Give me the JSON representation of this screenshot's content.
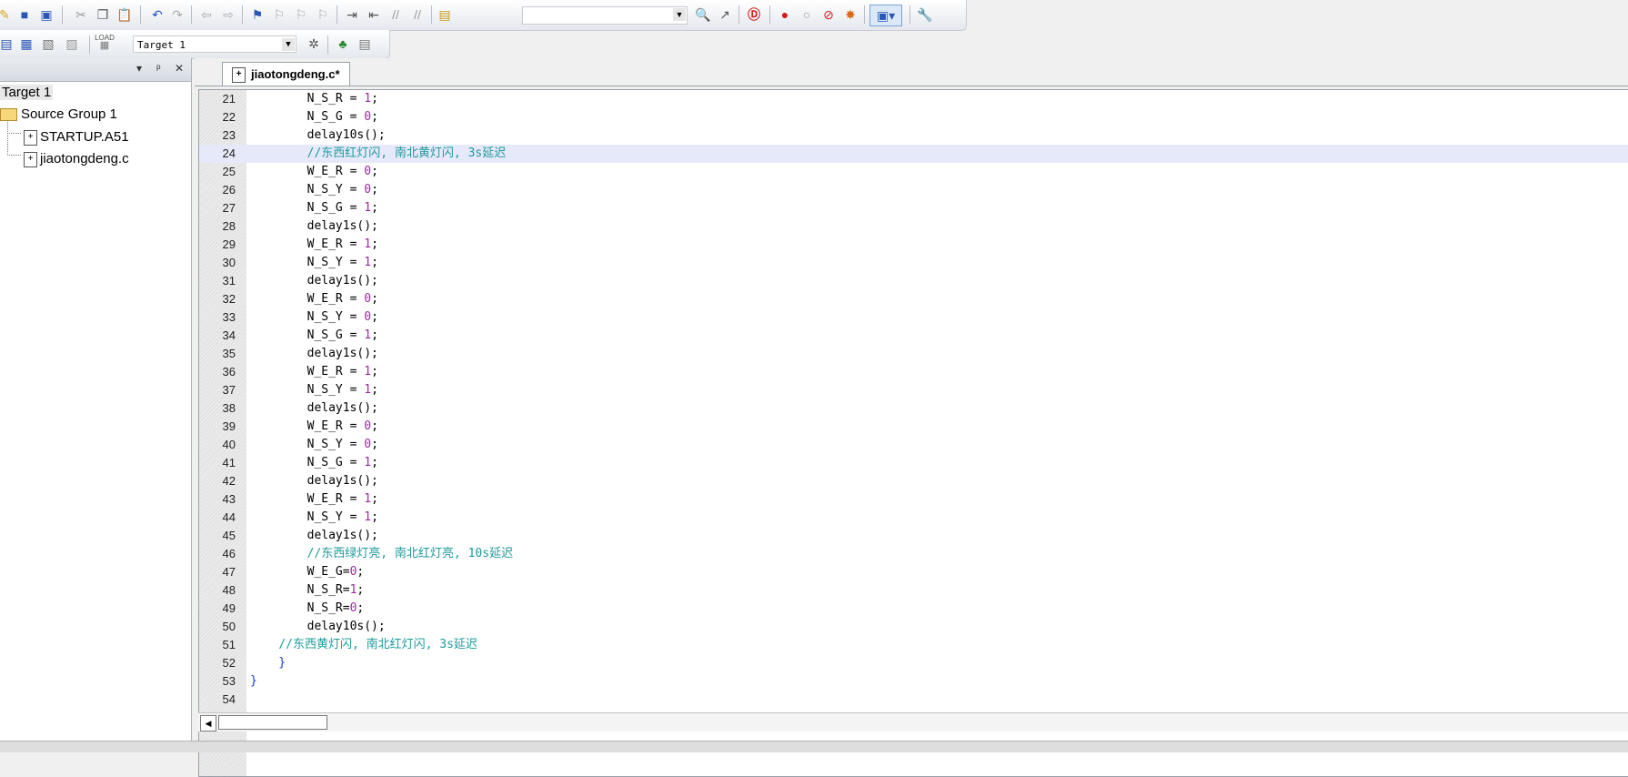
{
  "toolbar": {
    "icons": [
      "new-file-icon",
      "save-icon",
      "save-all-icon",
      "cut-icon",
      "copy-icon",
      "paste-icon",
      "undo-icon",
      "redo-icon",
      "back-icon",
      "forward-icon",
      "bookmark-icon",
      "prev-bookmark-icon",
      "next-bookmark-icon",
      "clear-bookmarks-icon",
      "indent-icon",
      "unindent-icon",
      "comment-icon",
      "uncomment-icon",
      "find-in-files-icon",
      "search-icon",
      "incremental-find-icon",
      "debug-icon",
      "breakpoint-icon",
      "disable-breakpoint-icon",
      "kill-breakpoints-icon",
      "enable-breakpoints-icon",
      "window-icon",
      "settings-icon"
    ],
    "find_value": ""
  },
  "build_toolbar": {
    "target_value": "Target 1",
    "load_label": "LOAD"
  },
  "project": {
    "target": "Target 1",
    "group": "Source Group 1",
    "files": [
      "STARTUP.A51",
      "jiaotongdeng.c"
    ]
  },
  "editor": {
    "tab_label": "jiaotongdeng.c*",
    "highlighted_line": 24,
    "lines": [
      {
        "n": "21",
        "code": "        N_S_R = 1;"
      },
      {
        "n": "22",
        "code": "        N_S_G = 0;"
      },
      {
        "n": "23",
        "code": "        delay10s();"
      },
      {
        "n": "24",
        "code": "        //东西红灯闪, 南北黄灯闪, 3s延迟"
      },
      {
        "n": "25",
        "code": "        W_E_R = 0;"
      },
      {
        "n": "26",
        "code": "        N_S_Y = 0;"
      },
      {
        "n": "27",
        "code": "        N_S_G = 1;"
      },
      {
        "n": "28",
        "code": "        delay1s();"
      },
      {
        "n": "29",
        "code": "        W_E_R = 1;"
      },
      {
        "n": "30",
        "code": "        N_S_Y = 1;"
      },
      {
        "n": "31",
        "code": "        delay1s();"
      },
      {
        "n": "32",
        "code": "        W_E_R = 0;"
      },
      {
        "n": "33",
        "code": "        N_S_Y = 0;"
      },
      {
        "n": "34",
        "code": "        N_S_G = 1;"
      },
      {
        "n": "35",
        "code": "        delay1s();"
      },
      {
        "n": "36",
        "code": "        W_E_R = 1;"
      },
      {
        "n": "37",
        "code": "        N_S_Y = 1;"
      },
      {
        "n": "38",
        "code": "        delay1s();"
      },
      {
        "n": "39",
        "code": "        W_E_R = 0;"
      },
      {
        "n": "40",
        "code": "        N_S_Y = 0;"
      },
      {
        "n": "41",
        "code": "        N_S_G = 1;"
      },
      {
        "n": "42",
        "code": "        delay1s();"
      },
      {
        "n": "43",
        "code": "        W_E_R = 1;"
      },
      {
        "n": "44",
        "code": "        N_S_Y = 1;"
      },
      {
        "n": "45",
        "code": "        delay1s();"
      },
      {
        "n": "46",
        "code": "        //东西绿灯亮, 南北红灯亮, 10s延迟"
      },
      {
        "n": "47",
        "code": "        W_E_G=0;"
      },
      {
        "n": "48",
        "code": "        N_S_R=1;"
      },
      {
        "n": "49",
        "code": "        N_S_R=0;"
      },
      {
        "n": "50",
        "code": "        delay10s();"
      },
      {
        "n": "51",
        "code": "    //东西黄灯闪, 南北红灯闪, 3s延迟"
      },
      {
        "n": "52",
        "code": "    }"
      },
      {
        "n": "53",
        "code": "}"
      },
      {
        "n": "54",
        "code": ""
      }
    ]
  }
}
